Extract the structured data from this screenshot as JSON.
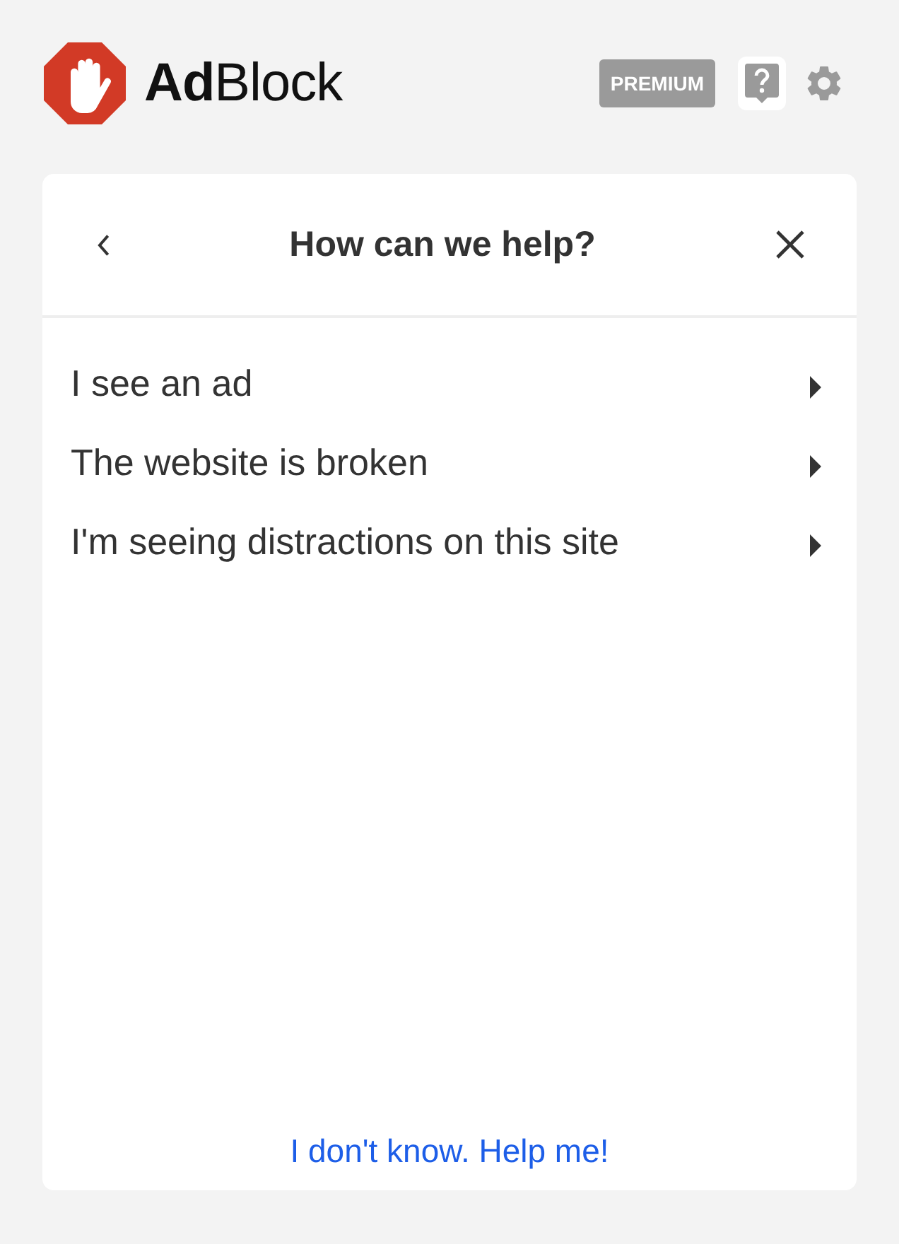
{
  "header": {
    "logo_text": "**Ad**Block",
    "premium_label": "PREMIUM",
    "tools": [
      {
        "kind": "help",
        "selected": true
      },
      {
        "kind": "settings",
        "selected": false
      }
    ]
  },
  "panel": {
    "title": "How can we help?",
    "options": [
      {
        "label": "I see an ad"
      },
      {
        "label": "The website is broken"
      },
      {
        "label": "I'm seeing distractions on this site"
      }
    ],
    "footer_link": "I don't know. Help me!"
  }
}
